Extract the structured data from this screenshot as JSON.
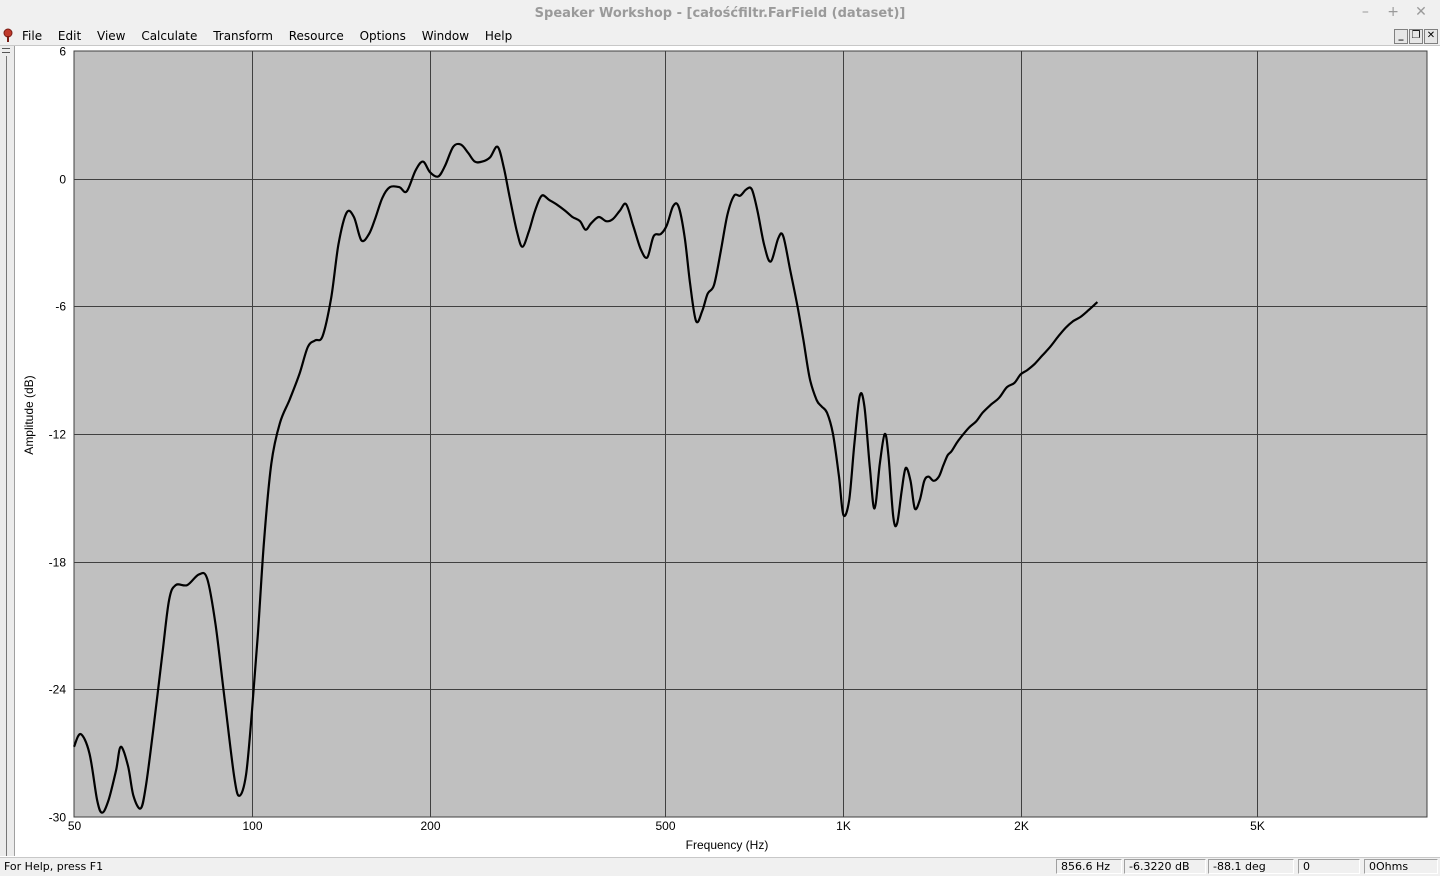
{
  "window": {
    "title": "Speaker Workshop - [całośćfiltr.FarField (dataset)]",
    "controls": [
      "–",
      "+",
      "✕"
    ]
  },
  "menu": {
    "items": [
      {
        "label": "File",
        "underline": "F"
      },
      {
        "label": "Edit",
        "underline": "E"
      },
      {
        "label": "View",
        "underline": "V"
      },
      {
        "label": "Calculate",
        "underline": "C"
      },
      {
        "label": "Transform",
        "underline": "T"
      },
      {
        "label": "Resource",
        "underline": "R"
      },
      {
        "label": "Options",
        "underline": "O"
      },
      {
        "label": "Window",
        "underline": "W"
      },
      {
        "label": "Help",
        "underline": "H"
      }
    ],
    "mdi_controls": [
      "_",
      "❐",
      "✕"
    ]
  },
  "status": {
    "help_text": "For Help, press F1",
    "frequency": "856.6 Hz",
    "amplitude": "-6.3220 dB",
    "phase": "-88.1 deg",
    "pane4": "0",
    "impedance": "0Ohms"
  },
  "colors": {
    "plot_background": "#c0c0c0",
    "grid": "#404040",
    "curve": "#000000"
  },
  "chart_data": {
    "type": "line",
    "title": "",
    "xlabel": "Frequency (Hz)",
    "ylabel": "Amplitude (dB)",
    "x_scale": "log",
    "xlim": [
      50,
      9700
    ],
    "ylim": [
      -30,
      6
    ],
    "x_ticks": [
      {
        "value": 50,
        "label": "50"
      },
      {
        "value": 100,
        "label": "100"
      },
      {
        "value": 200,
        "label": "200"
      },
      {
        "value": 500,
        "label": "500"
      },
      {
        "value": 1000,
        "label": "1K"
      },
      {
        "value": 2000,
        "label": "2K"
      },
      {
        "value": 5000,
        "label": "5K"
      }
    ],
    "y_ticks": [
      {
        "value": 6,
        "label": "6"
      },
      {
        "value": 0,
        "label": "0"
      },
      {
        "value": -6,
        "label": "-6"
      },
      {
        "value": -12,
        "label": "-12"
      },
      {
        "value": -18,
        "label": "-18"
      },
      {
        "value": -24,
        "label": "-24"
      },
      {
        "value": -30,
        "label": "-30"
      }
    ],
    "grid": true,
    "series": [
      {
        "name": "",
        "points": [
          [
            50.0,
            -26.7
          ],
          [
            51.3,
            -26.1
          ],
          [
            53.1,
            -27.0
          ],
          [
            54.7,
            -29.2
          ],
          [
            55.8,
            -29.8
          ],
          [
            57.2,
            -29.2
          ],
          [
            58.9,
            -27.8
          ],
          [
            60.0,
            -26.7
          ],
          [
            61.7,
            -27.6
          ],
          [
            63.0,
            -29.0
          ],
          [
            64.8,
            -29.6
          ],
          [
            66.1,
            -28.6
          ],
          [
            68.0,
            -26.0
          ],
          [
            70.5,
            -22.4
          ],
          [
            72.4,
            -19.8
          ],
          [
            74.3,
            -19.1
          ],
          [
            77.7,
            -19.1
          ],
          [
            81.3,
            -18.6
          ],
          [
            84.0,
            -18.8
          ],
          [
            86.8,
            -21.0
          ],
          [
            90.0,
            -24.6
          ],
          [
            93.4,
            -28.2
          ],
          [
            95.3,
            -29.0
          ],
          [
            97.7,
            -28.0
          ],
          [
            100.0,
            -25.0
          ],
          [
            102.3,
            -21.4
          ],
          [
            104.8,
            -17.0
          ],
          [
            107.8,
            -13.4
          ],
          [
            111.4,
            -11.5
          ],
          [
            115.7,
            -10.4
          ],
          [
            120.2,
            -9.2
          ],
          [
            124.3,
            -7.9
          ],
          [
            127.9,
            -7.6
          ],
          [
            131.6,
            -7.4
          ],
          [
            136.1,
            -5.6
          ],
          [
            140.0,
            -3.1
          ],
          [
            144.5,
            -1.6
          ],
          [
            148.7,
            -1.8
          ],
          [
            153.1,
            -2.9
          ],
          [
            157.7,
            -2.6
          ],
          [
            161.4,
            -1.9
          ],
          [
            166.1,
            -0.9
          ],
          [
            171.0,
            -0.4
          ],
          [
            177.5,
            -0.4
          ],
          [
            182.6,
            -0.6
          ],
          [
            189.1,
            0.4
          ],
          [
            194.6,
            0.8
          ],
          [
            200.0,
            0.3
          ],
          [
            206.4,
            0.1
          ],
          [
            212.0,
            0.6
          ],
          [
            218.9,
            1.5
          ],
          [
            225.6,
            1.6
          ],
          [
            232.1,
            1.2
          ],
          [
            238.1,
            0.8
          ],
          [
            245.0,
            0.8
          ],
          [
            252.6,
            1.0
          ],
          [
            260.2,
            1.5
          ],
          [
            266.6,
            0.5
          ],
          [
            272.8,
            -0.9
          ],
          [
            280.6,
            -2.5
          ],
          [
            286.5,
            -3.2
          ],
          [
            293.7,
            -2.5
          ],
          [
            301.0,
            -1.5
          ],
          [
            308.9,
            -0.8
          ],
          [
            318.0,
            -1.0
          ],
          [
            326.9,
            -1.2
          ],
          [
            338.2,
            -1.5
          ],
          [
            348.3,
            -1.8
          ],
          [
            358.6,
            -2.0
          ],
          [
            366.4,
            -2.4
          ],
          [
            374.4,
            -2.1
          ],
          [
            385.7,
            -1.8
          ],
          [
            397.2,
            -2.0
          ],
          [
            407.4,
            -1.9
          ],
          [
            418.8,
            -1.5
          ],
          [
            429.1,
            -1.2
          ],
          [
            441.0,
            -2.2
          ],
          [
            454.0,
            -3.3
          ],
          [
            465.9,
            -3.7
          ],
          [
            477.7,
            -2.7
          ],
          [
            491.1,
            -2.6
          ],
          [
            502.6,
            -2.2
          ],
          [
            515.1,
            -1.3
          ],
          [
            526.1,
            -1.3
          ],
          [
            538.7,
            -2.7
          ],
          [
            550.3,
            -4.9
          ],
          [
            563.5,
            -6.7
          ],
          [
            577.4,
            -6.2
          ],
          [
            589.5,
            -5.4
          ],
          [
            604.2,
            -5.0
          ],
          [
            620.4,
            -3.4
          ],
          [
            636.6,
            -1.7
          ],
          [
            653.3,
            -0.8
          ],
          [
            669.1,
            -0.8
          ],
          [
            685.3,
            -0.5
          ],
          [
            699.9,
            -0.5
          ],
          [
            715.5,
            -1.5
          ],
          [
            734.2,
            -3.1
          ],
          [
            753.3,
            -3.9
          ],
          [
            775.9,
            -2.8
          ],
          [
            790.9,
            -2.7
          ],
          [
            812.9,
            -4.3
          ],
          [
            836.3,
            -6.0
          ],
          [
            856.0,
            -7.6
          ],
          [
            877.4,
            -9.4
          ],
          [
            900.9,
            -10.4
          ],
          [
            918.1,
            -10.7
          ],
          [
            937.9,
            -11.0
          ],
          [
            960.1,
            -12.0
          ],
          [
            982.8,
            -14.0
          ],
          [
            1000.0,
            -15.8
          ],
          [
            1022.6,
            -15.1
          ],
          [
            1044.0,
            -12.4
          ],
          [
            1065.8,
            -10.2
          ],
          [
            1085.2,
            -10.7
          ],
          [
            1108.5,
            -13.6
          ],
          [
            1128.6,
            -15.5
          ],
          [
            1152.2,
            -13.4
          ],
          [
            1174.5,
            -12.0
          ],
          [
            1191.5,
            -13.0
          ],
          [
            1214.2,
            -15.9
          ],
          [
            1232.5,
            -16.2
          ],
          [
            1254.3,
            -14.7
          ],
          [
            1274.3,
            -13.6
          ],
          [
            1298.4,
            -14.2
          ],
          [
            1320.4,
            -15.5
          ],
          [
            1346.2,
            -15.1
          ],
          [
            1370.1,
            -14.2
          ],
          [
            1392.8,
            -14.0
          ],
          [
            1420.5,
            -14.2
          ],
          [
            1450.1,
            -14.0
          ],
          [
            1474.2,
            -13.5
          ],
          [
            1500.3,
            -13.0
          ],
          [
            1524.6,
            -12.8
          ],
          [
            1556.0,
            -12.4
          ],
          [
            1585.2,
            -12.1
          ],
          [
            1630.5,
            -11.7
          ],
          [
            1677.7,
            -11.4
          ],
          [
            1719.4,
            -11.0
          ],
          [
            1779.4,
            -10.6
          ],
          [
            1833.6,
            -10.3
          ],
          [
            1889.5,
            -9.8
          ],
          [
            1946.0,
            -9.6
          ],
          [
            1993.3,
            -9.2
          ],
          [
            2044.8,
            -9.0
          ],
          [
            2106.5,
            -8.7
          ],
          [
            2170.8,
            -8.3
          ],
          [
            2236.8,
            -7.9
          ],
          [
            2310.3,
            -7.4
          ],
          [
            2376.8,
            -7.0
          ],
          [
            2444.7,
            -6.7
          ],
          [
            2515.6,
            -6.5
          ],
          [
            2592.0,
            -6.2
          ],
          [
            2688.2,
            -5.8
          ]
        ]
      }
    ]
  }
}
